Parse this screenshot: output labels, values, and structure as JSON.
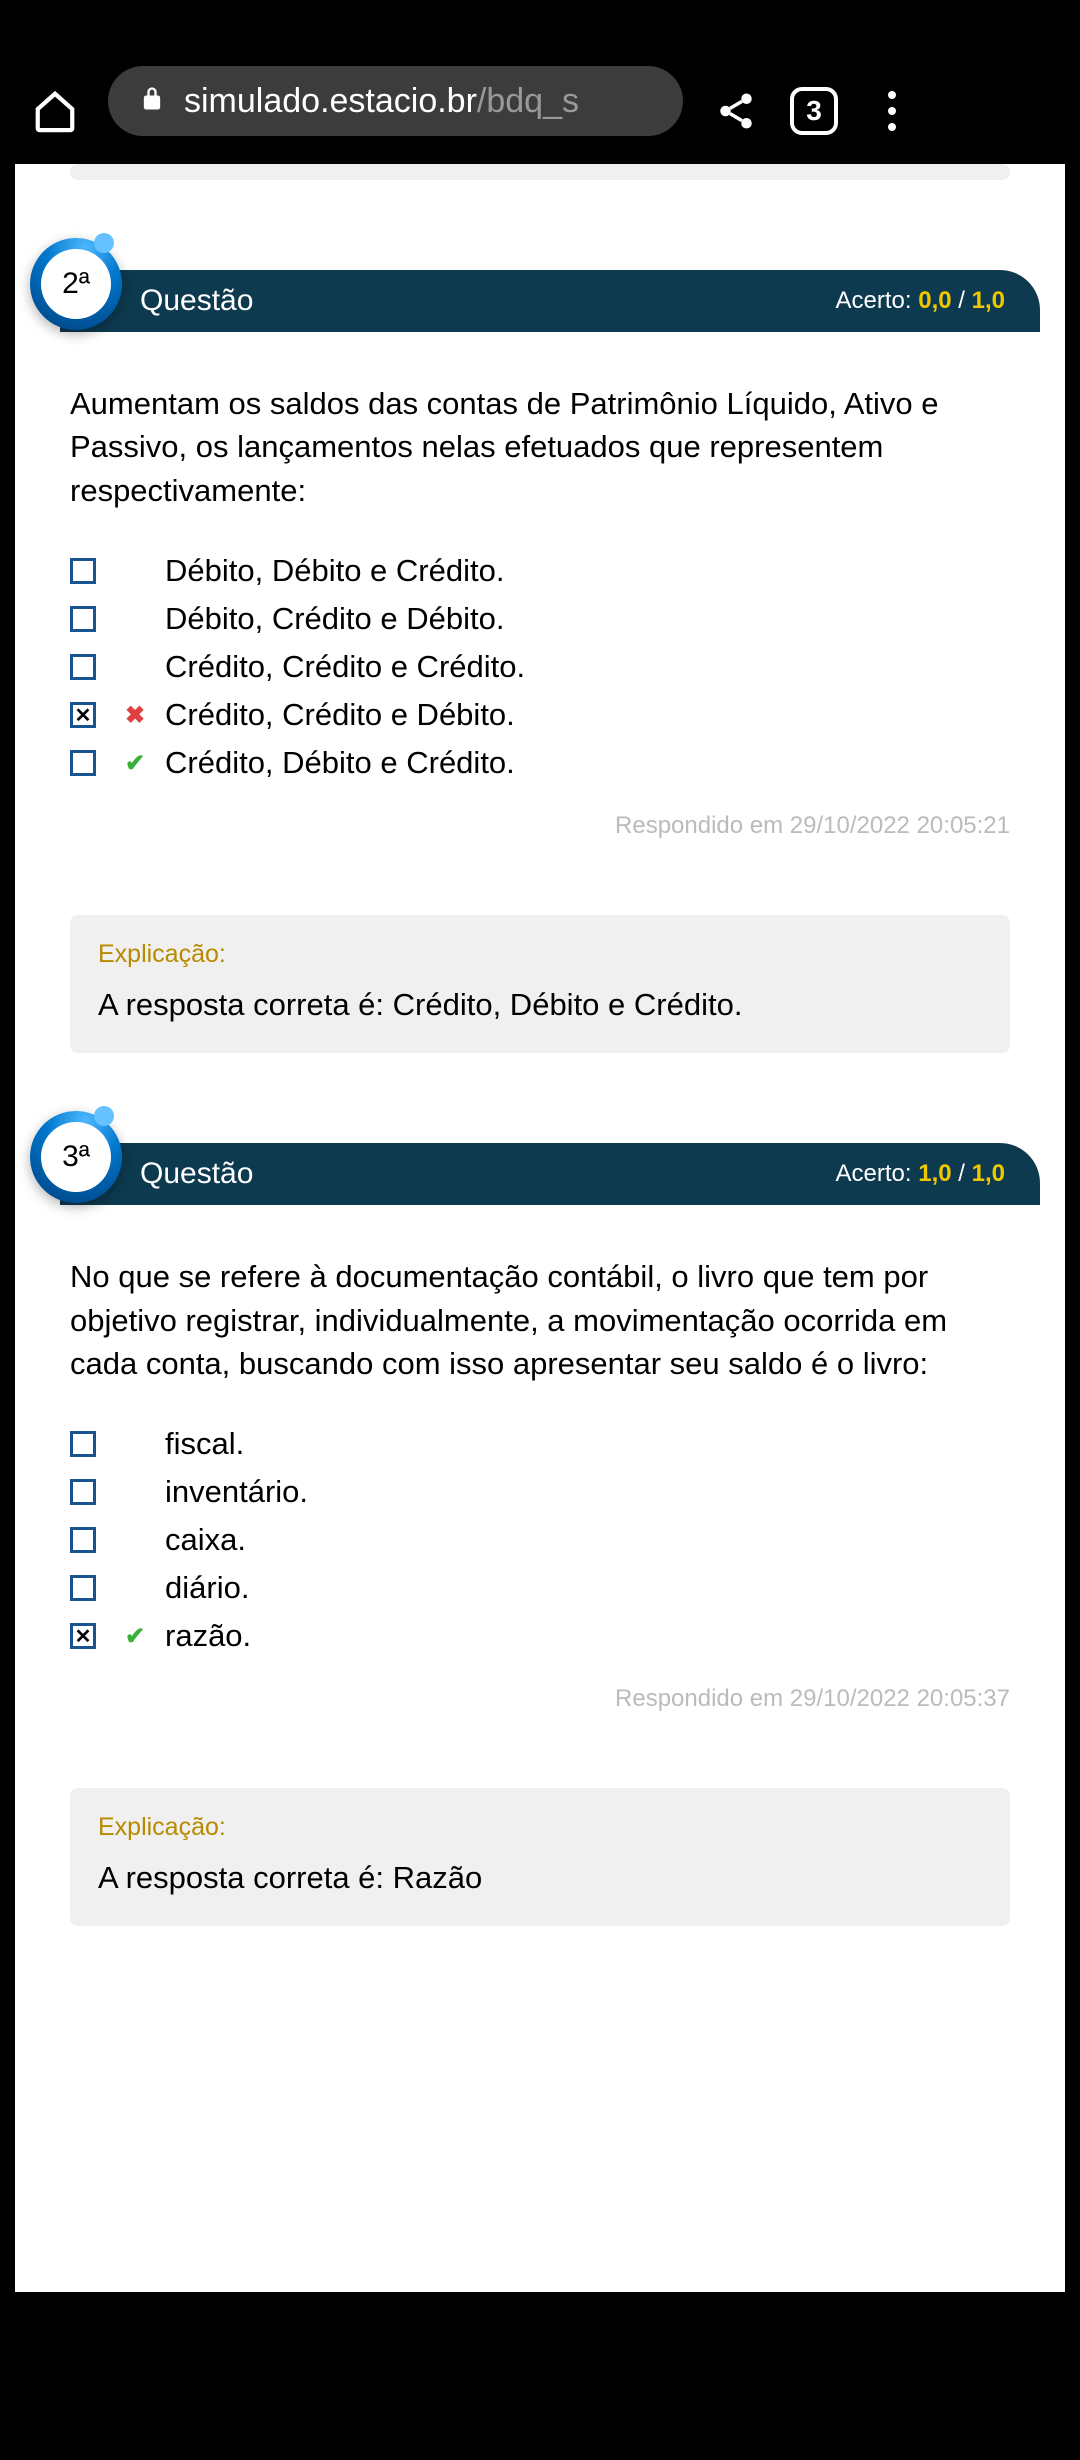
{
  "browser": {
    "url_domain": "simulado.estacio.br",
    "url_path": "/bdq_s",
    "tab_count": "3"
  },
  "questions": [
    {
      "number": "2ª",
      "title": "Questão",
      "score_label": "Acerto:",
      "score_earned": "0,0",
      "score_sep": " / ",
      "score_total": "1,0",
      "text": "Aumentam os saldos das contas de Patrimônio Líquido, Ativo e Passivo, os lançamentos nelas efetuados que representem respectivamente:",
      "options": [
        {
          "label": "Débito, Débito e Crédito.",
          "checked": false,
          "result": ""
        },
        {
          "label": "Débito, Crédito e Débito.",
          "checked": false,
          "result": ""
        },
        {
          "label": "Crédito, Crédito e Crédito.",
          "checked": false,
          "result": ""
        },
        {
          "label": "Crédito, Crédito e Débito.",
          "checked": true,
          "result": "wrong"
        },
        {
          "label": "Crédito, Débito e Crédito.",
          "checked": false,
          "result": "right"
        }
      ],
      "timestamp": "Respondido em 29/10/2022 20:05:21",
      "expl_label": "Explicação:",
      "expl_text": "A resposta correta é: Crédito, Débito e Crédito."
    },
    {
      "number": "3ª",
      "title": "Questão",
      "score_label": "Acerto:",
      "score_earned": "1,0",
      "score_sep": " / ",
      "score_total": "1,0",
      "text": "No que se refere à documentação contábil, o livro que tem por objetivo registrar, individualmente, a movimentação ocorrida em cada conta, buscando com isso apresentar seu saldo é o livro:",
      "options": [
        {
          "label": "fiscal.",
          "checked": false,
          "result": ""
        },
        {
          "label": "inventário.",
          "checked": false,
          "result": ""
        },
        {
          "label": "caixa.",
          "checked": false,
          "result": ""
        },
        {
          "label": "diário.",
          "checked": false,
          "result": ""
        },
        {
          "label": "razão.",
          "checked": true,
          "result": "right"
        }
      ],
      "timestamp": "Respondido em 29/10/2022 20:05:37",
      "expl_label": "Explicação:",
      "expl_text": "A resposta correta é: Razão"
    }
  ]
}
